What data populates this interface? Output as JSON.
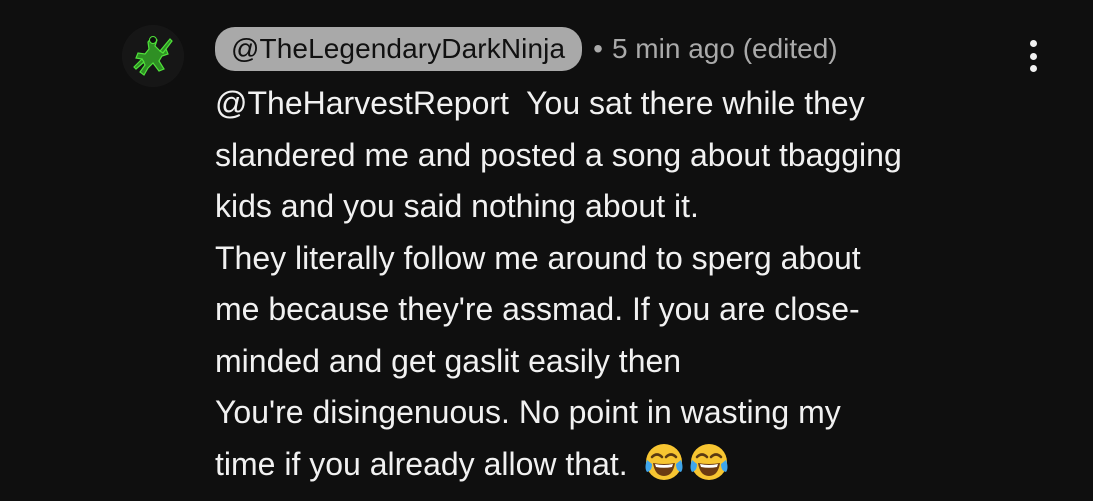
{
  "comment": {
    "author_handle": "@TheLegendaryDarkNinja",
    "separator": "•",
    "meta": "5 min ago (edited)",
    "mention": "@TheHarvestReport",
    "lines": [
      "  You sat there while they",
      "slandered me and posted a song about tbagging",
      "kids and you said nothing about it.",
      "They literally follow me around to sperg about",
      "me because they're assmad. If you are close-",
      "minded and get gaslit easily then",
      "You're disingenuous. No point in wasting my",
      "time if you already allow that. "
    ],
    "emojis": [
      "face-with-tears-of-joy-icon",
      "face-with-tears-of-joy-icon"
    ],
    "colors": {
      "background": "#0f0f0f",
      "text": "#f1f1f1",
      "meta": "#aaaaaa",
      "pill": "#a9a9a9",
      "avatar_accent": "#39d12a"
    }
  }
}
